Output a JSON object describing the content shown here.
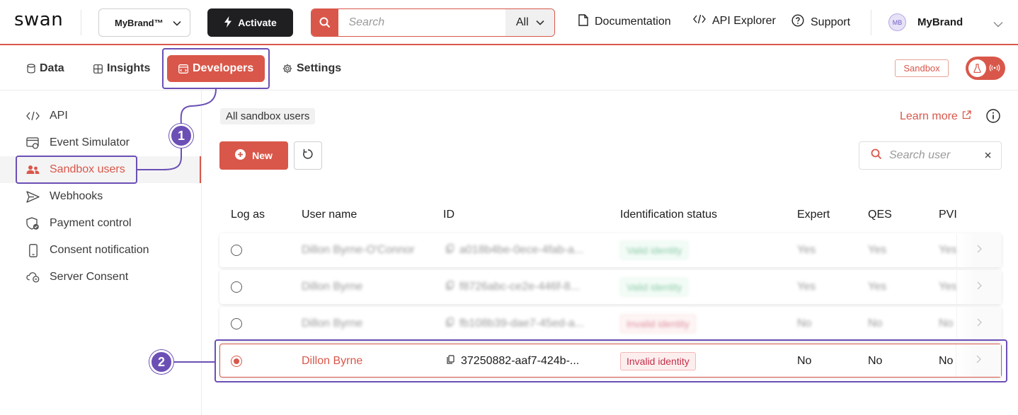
{
  "app": {
    "logo": "swan",
    "accent": "#d9574a",
    "annotation_color": "#6b4fb5"
  },
  "topbar": {
    "brand_select": "MyBrand™",
    "activate_label": "Activate",
    "search": {
      "placeholder": "Search",
      "scope": "All"
    },
    "links": {
      "documentation": "Documentation",
      "api_explorer": "API Explorer",
      "support": "Support"
    },
    "user": {
      "initials": "MB",
      "name": "MyBrand"
    }
  },
  "nav": {
    "tabs": [
      {
        "label": "Data",
        "icon": "database-icon"
      },
      {
        "label": "Insights",
        "icon": "insights-icon"
      },
      {
        "label": "Developers",
        "icon": "developers-icon",
        "active": true
      },
      {
        "label": "Settings",
        "icon": "gear-icon"
      }
    ],
    "sandbox_badge": "Sandbox"
  },
  "sidebar": {
    "items": [
      {
        "label": "API",
        "icon": "code-icon"
      },
      {
        "label": "Event Simulator",
        "icon": "event-simulator-icon"
      },
      {
        "label": "Sandbox users",
        "icon": "people-icon",
        "active": true
      },
      {
        "label": "Webhooks",
        "icon": "send-icon"
      },
      {
        "label": "Payment control",
        "icon": "shield-check-icon"
      },
      {
        "label": "Consent notification",
        "icon": "phone-icon"
      },
      {
        "label": "Server Consent",
        "icon": "cloud-icon"
      }
    ]
  },
  "main": {
    "breadcrumb": "All sandbox users",
    "learn_more": "Learn more",
    "new_label": "New",
    "search_user_placeholder": "Search user",
    "columns": [
      "Log as",
      "User name",
      "ID",
      "Identification status",
      "Expert",
      "QES",
      "PVI"
    ],
    "rows": [
      {
        "name": "Dillon Byrne-O'Connor",
        "id": "a018b4be-0ece-4fab-a...",
        "status": "Valid identity",
        "status_type": "valid",
        "expert": "Yes",
        "qes": "Yes",
        "pvi": "Yes",
        "selected": false,
        "dimmed": true
      },
      {
        "name": "Dillon Byrne",
        "id": "f8726abc-ce2e-446f-8...",
        "status": "Valid identity",
        "status_type": "valid",
        "expert": "Yes",
        "qes": "Yes",
        "pvi": "Yes",
        "selected": false,
        "dimmed": true
      },
      {
        "name": "Dillon Byrne",
        "id": "fb108b39-dae7-45ed-a...",
        "status": "Invalid identity",
        "status_type": "invalid",
        "expert": "No",
        "qes": "No",
        "pvi": "No",
        "selected": false,
        "dimmed": true
      },
      {
        "name": "Dillon Byrne",
        "id": "37250882-aaf7-424b-...",
        "status": "Invalid identity",
        "status_type": "invalid",
        "expert": "No",
        "qes": "No",
        "pvi": "No",
        "selected": true,
        "dimmed": false
      }
    ]
  },
  "callouts": [
    "1",
    "2"
  ]
}
